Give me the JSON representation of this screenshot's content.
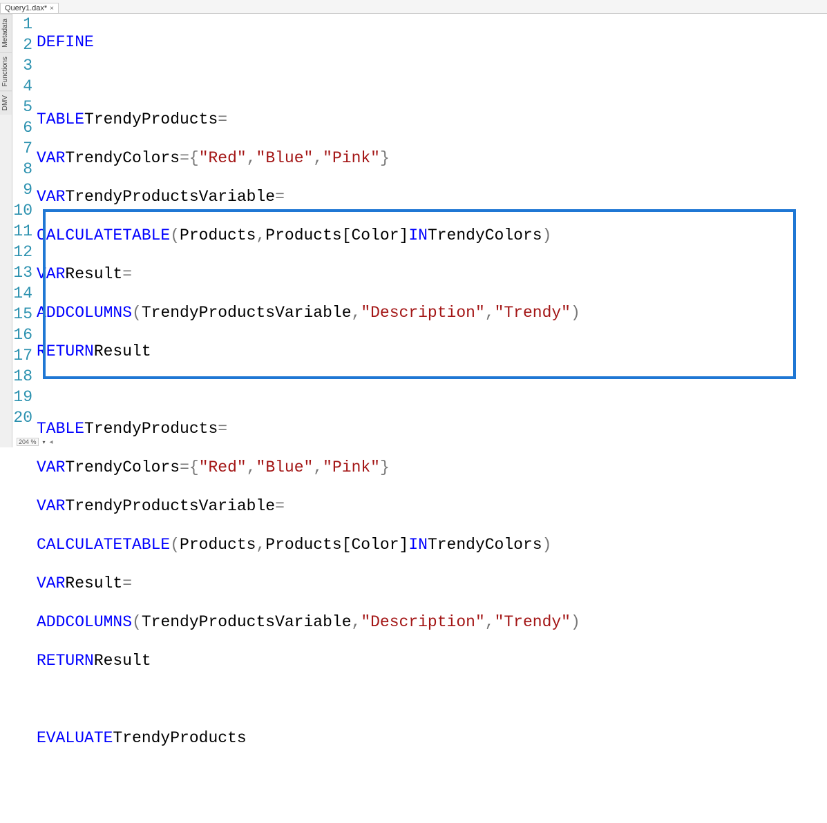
{
  "tab": {
    "title": "Query1.dax*",
    "close": "×"
  },
  "side_tabs": [
    "Metadata",
    "Functions",
    "DMV"
  ],
  "gutter": [
    "1",
    "2",
    "3",
    "4",
    "5",
    "6",
    "7",
    "8",
    "9",
    "10",
    "11",
    "12",
    "13",
    "14",
    "15",
    "16",
    "17",
    "18",
    "19",
    "20"
  ],
  "tokens": {
    "DEFINE": "DEFINE",
    "TABLE": "TABLE",
    "VAR": "VAR",
    "RETURN": "RETURN",
    "IN": "IN",
    "EVALUATE": "EVALUATE",
    "CALCULATETABLE": "CALCULATETABLE",
    "ADDCOLUMNS": "ADDCOLUMNS",
    "TrendyProducts": "TrendyProducts",
    "TrendyColors": "TrendyColors",
    "TrendyProductsVariable": "TrendyProductsVariable",
    "Result": "Result",
    "Products": "Products",
    "ProductsColor": "Products[Color]",
    "eq": "=",
    "lbrace": "{",
    "rbrace": "}",
    "lparen": "(",
    "rparen": ")",
    "comma": ",",
    "str_Red": "\"Red\"",
    "str_Blue": "\"Blue\"",
    "str_Pink": "\"Pink\"",
    "str_Description": "\"Description\"",
    "str_Trendy": "\"Trendy\""
  },
  "status": {
    "zoom": "204 %",
    "arrow": "◂"
  }
}
